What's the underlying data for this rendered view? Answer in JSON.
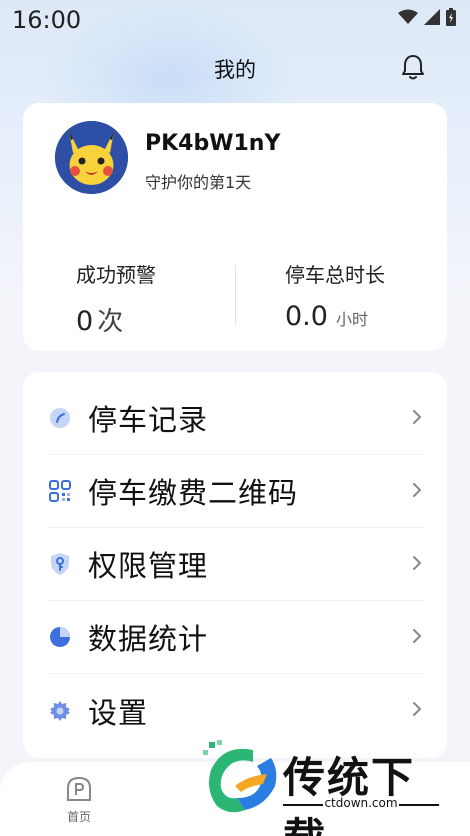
{
  "status_bar": {
    "time": "16:00"
  },
  "header": {
    "title": "我的"
  },
  "profile": {
    "username": "PK4bW1nY",
    "guard_text": "守护你的第1天"
  },
  "stats": {
    "warnings_label": "成功预警",
    "warnings_value": "0",
    "warnings_unit": "次",
    "parking_label": "停车总时长",
    "parking_value": "0.0",
    "parking_unit": "小时"
  },
  "menu": {
    "items": [
      {
        "label": "停车记录",
        "icon": "clock-icon"
      },
      {
        "label": "停车缴费二维码",
        "icon": "qrcode-icon"
      },
      {
        "label": "权限管理",
        "icon": "shield-key-icon"
      },
      {
        "label": "数据统计",
        "icon": "pie-chart-icon"
      },
      {
        "label": "设置",
        "icon": "gear-icon"
      }
    ]
  },
  "bottom_nav": {
    "home_label": "首页"
  },
  "watermark": {
    "text": "传统下载",
    "url": "ctdown.com"
  },
  "colors": {
    "accent": "#3d6fe0",
    "card": "#ffffff",
    "background": "#f3f5fa"
  }
}
